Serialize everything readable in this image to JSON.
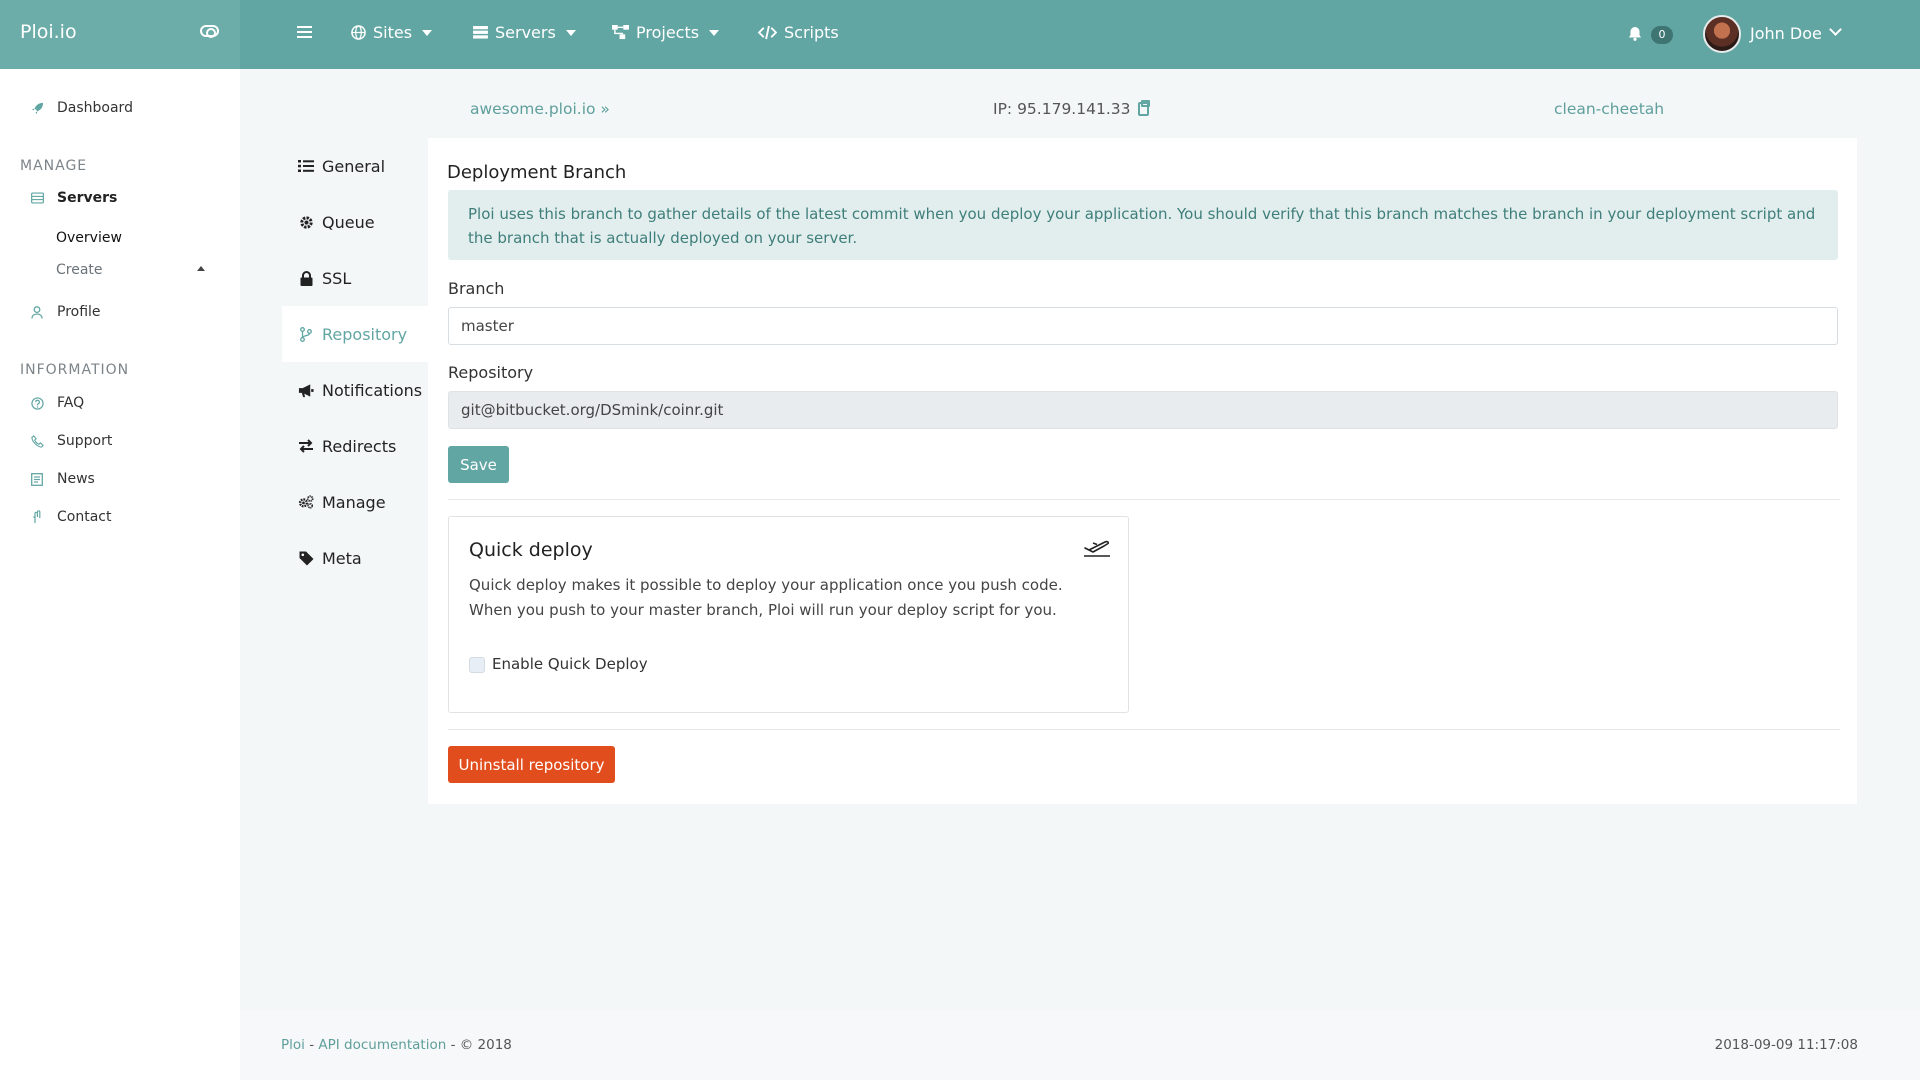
{
  "topbar": {
    "brand": "Ploi.io",
    "nav": [
      {
        "label": "Sites",
        "icon": "globe-icon"
      },
      {
        "label": "Servers",
        "icon": "server-icon"
      },
      {
        "label": "Projects",
        "icon": "sitemap-icon"
      },
      {
        "label": "Scripts",
        "icon": "code-icon"
      }
    ],
    "notification_count": "0",
    "user_name": "John Doe"
  },
  "sidebar": {
    "dashboard": "Dashboard",
    "manage_heading": "MANAGE",
    "servers": "Servers",
    "servers_sub": [
      "Overview",
      "Create"
    ],
    "profile": "Profile",
    "information_heading": "INFORMATION",
    "info_items": [
      "FAQ",
      "Support",
      "News",
      "Contact"
    ]
  },
  "breadcrumb": {
    "site": "awesome.ploi.io",
    "ip": "IP: 95.179.141.33",
    "server": "clean-cheetah"
  },
  "subnav": {
    "items": [
      {
        "label": "General",
        "icon": "list-icon"
      },
      {
        "label": "Queue",
        "icon": "cog-icon"
      },
      {
        "label": "SSL",
        "icon": "lock-icon"
      },
      {
        "label": "Repository",
        "icon": "branch-icon"
      },
      {
        "label": "Notifications",
        "icon": "bullhorn-icon"
      },
      {
        "label": "Redirects",
        "icon": "exchange-icon"
      },
      {
        "label": "Manage",
        "icon": "cogs-icon"
      },
      {
        "label": "Meta",
        "icon": "tag-icon"
      }
    ],
    "active": "Repository"
  },
  "main": {
    "title": "Deployment Branch",
    "alert": "Ploi uses this branch to gather details of the latest commit when you deploy your application. You should verify that this branch matches the branch in your deployment script and the branch that is actually deployed on your server.",
    "branch_label": "Branch",
    "branch_value": "master",
    "repository_label": "Repository",
    "repository_value": "git@bitbucket.org/DSmink/coinr.git",
    "save_label": "Save",
    "quick_deploy": {
      "title": "Quick deploy",
      "text": "Quick deploy makes it possible to deploy your application once you push code. When you push to your master branch, Ploi will run your deploy script for you.",
      "checkbox_label": "Enable Quick Deploy",
      "checked": false
    },
    "uninstall_label": "Uninstall repository"
  },
  "footer": {
    "ploi": "Ploi",
    "sep1": " - ",
    "api": "API documentation",
    "copy": " - © 2018",
    "timestamp": "2018-09-09 11:17:08"
  },
  "colors": {
    "accent": "#62a6a3",
    "danger": "#e24d1d",
    "alert_bg": "#e1eeed"
  }
}
